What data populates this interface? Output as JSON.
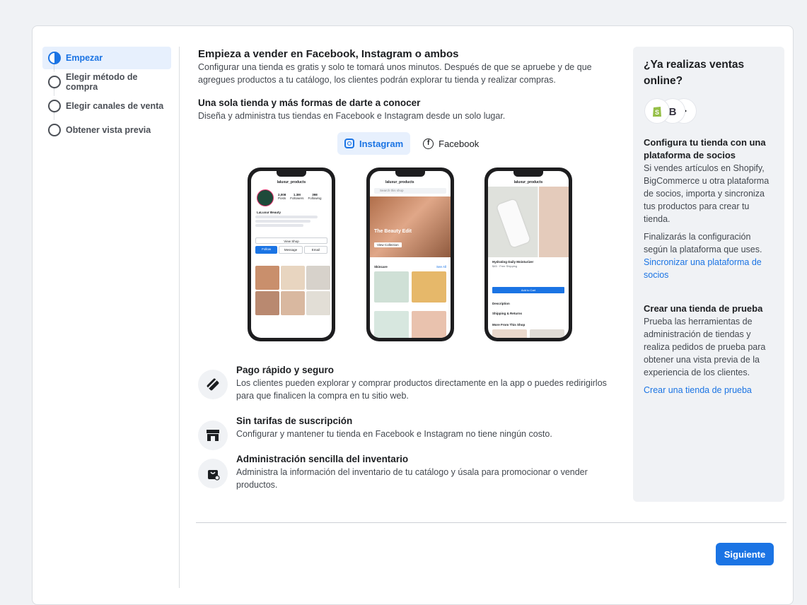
{
  "stepper": {
    "steps": [
      {
        "label": "Empezar",
        "state": "active"
      },
      {
        "label": "Elegir método de compra",
        "state": "pending"
      },
      {
        "label": "Elegir canales de venta",
        "state": "pending"
      },
      {
        "label": "Obtener vista previa",
        "state": "pending"
      }
    ]
  },
  "main": {
    "title": "Empieza a vender en Facebook, Instagram o ambos",
    "intro": "Configurar una tienda es gratis y solo te tomará unos minutos. Después de que se apruebe y de que agregues productos a tu catálogo, los clientes podrán explorar tu tienda y realizar compras.",
    "subtitle": "Una sola tienda y más formas de darte a conocer",
    "subtext": "Diseña y administra tus tiendas en Facebook e Instagram desde un solo lugar.",
    "toggle": {
      "instagram": "Instagram",
      "facebook": "Facebook",
      "selected": "instagram"
    },
    "phones": {
      "handle": "laluxur_products",
      "brand_name": "LaLuxur Beauty",
      "stats": [
        {
          "value": "2,008",
          "label": "Posts"
        },
        {
          "value": "1.3M",
          "label": "Followers"
        },
        {
          "value": "398",
          "label": "Following"
        }
      ],
      "view_shop": "View Shop",
      "follow": "Follow",
      "message": "Message",
      "email": "Email",
      "search": "Search this shop",
      "beauty_edit": "The Beauty Edit",
      "view_collection": "View Collection",
      "skincare": "Skincare",
      "see_all": "See All",
      "product_name": "Hydrating Daily Moisturizer",
      "price": "$45 · Free Shipping",
      "add_to_cart": "Add to Cart",
      "description": "Description",
      "shipping": "Shipping & Returns",
      "more": "More From This Shop"
    },
    "features": [
      {
        "icon": "card-icon",
        "title": "Pago rápido y seguro",
        "text": "Los clientes pueden explorar y comprar productos directamente en la app o puedes redirigirlos para que finalicen la compra en tu sitio web."
      },
      {
        "icon": "storefront-icon",
        "title": "Sin tarifas de suscripción",
        "text": "Configurar y mantener tu tienda en Facebook e Instagram no tiene ningún costo."
      },
      {
        "icon": "inventory-bag-icon",
        "title": "Administración sencilla del inventario",
        "text": "Administra la información del inventario de tu catálogo y úsala para promocionar o vender productos."
      }
    ]
  },
  "side": {
    "title": "¿Ya realizas ventas online?",
    "partners": {
      "heading": "Configura tu tienda con una plataforma de socios",
      "text": "Si vendes artículos en Shopify, BigCommerce u otra plataforma de socios, importa y sincroniza tus productos para crear tu tienda.",
      "text2": "Finalizarás la configuración según la plataforma que uses.",
      "link": "Sincronizar una plataforma de socios"
    },
    "test_shop": {
      "heading": "Crear una tienda de prueba",
      "text": "Prueba las herramientas de administración de tiendas y realiza pedidos de prueba para obtener una vista previa de la experiencia de los clientes.",
      "link": "Crear una tienda de prueba"
    }
  },
  "footer": {
    "next_label": "Siguiente"
  },
  "colors": {
    "accent": "#1b74e4",
    "panel": "#f0f2f5",
    "shopify": "#95bf47"
  }
}
